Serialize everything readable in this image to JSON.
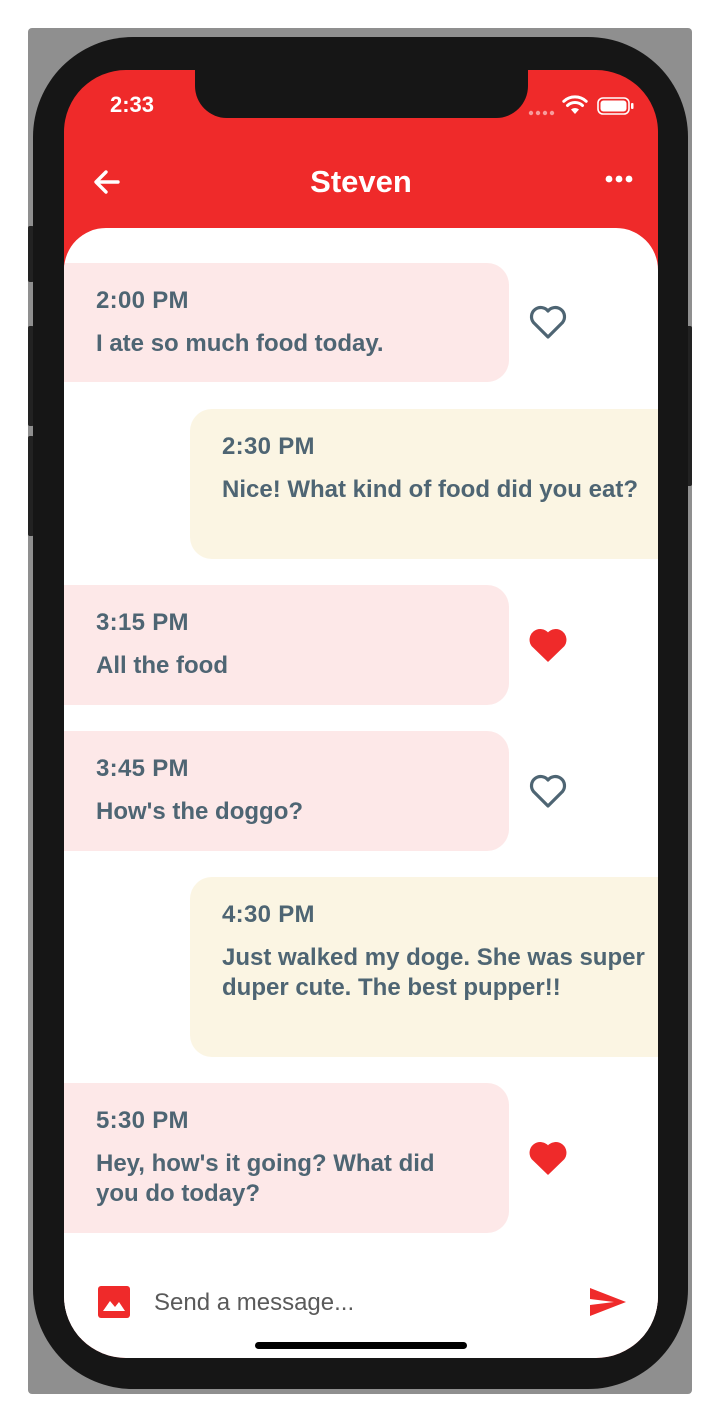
{
  "status_bar": {
    "time": "2:33"
  },
  "header": {
    "title": "Steven"
  },
  "messages": [
    {
      "time": "2:00 PM",
      "text": "I ate so much food today.",
      "liked": false
    },
    {
      "time": "2:30 PM",
      "text": "Nice! What kind of food did you eat?"
    },
    {
      "time": "3:15 PM",
      "text": "All the food",
      "liked": true
    },
    {
      "time": "3:45 PM",
      "text": "How's the doggo?",
      "liked": false
    },
    {
      "time": "4:30 PM",
      "text": "Just walked my doge. She was super duper cute. The best pupper!!"
    },
    {
      "time": "5:30 PM",
      "text": "Hey, how's it going? What did you do today?",
      "liked": true
    }
  ],
  "composer": {
    "placeholder": "Send a message..."
  },
  "icons": {
    "back": "back-arrow-icon",
    "more": "more-horizontal-icon",
    "like": "heart-icon",
    "image": "image-icon",
    "send": "send-icon"
  },
  "colors": {
    "accent": "#ef2a2a",
    "incoming_bubble": "#fde8e8",
    "outgoing_bubble": "#fbf5e3",
    "message_text": "#4e6573"
  }
}
